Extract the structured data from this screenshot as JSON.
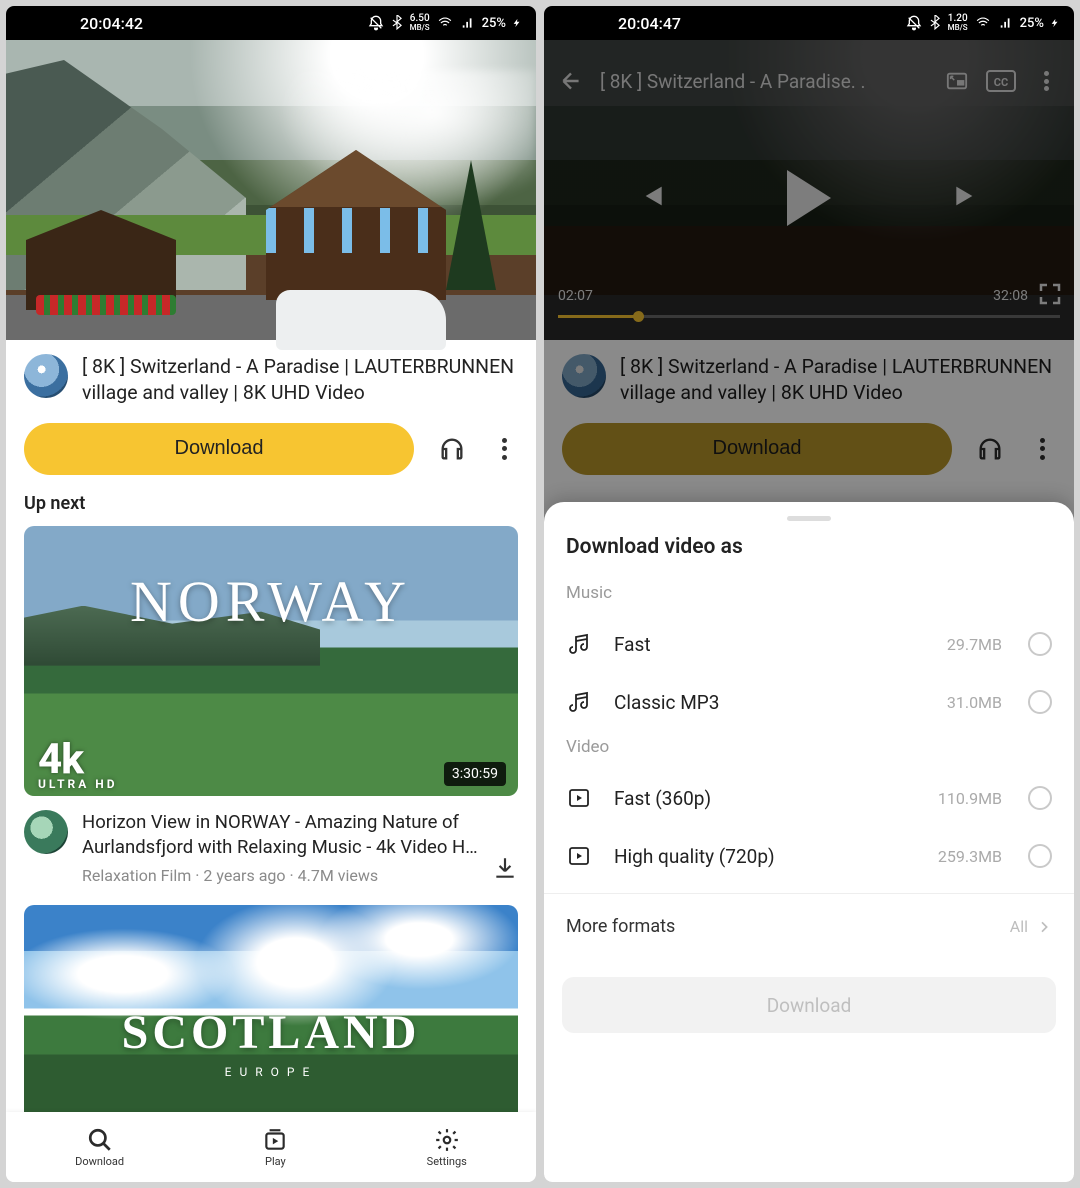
{
  "status_left": {
    "time": "20:04:42",
    "rate": "6.50",
    "rate_unit": "MB/S",
    "battery": "25%"
  },
  "status_right": {
    "time": "20:04:47",
    "rate": "1.20",
    "rate_unit": "MB/S",
    "battery": "25%"
  },
  "video": {
    "title": "[ 8K ] Switzerland - A Paradise | LAUTERBRUNNEN village and valley | 8K UHD Video",
    "download_label": "Download"
  },
  "player": {
    "title_short": "[ 8K ] Switzerland - A Paradise. .",
    "current": "02:07",
    "duration": "32:08"
  },
  "upnext": {
    "label": "Up next",
    "item": {
      "overlay_title": "NORWAY",
      "badge": "4k",
      "badge_sub": "ULTRA HD",
      "duration": "3:30:59",
      "title": "Horizon View in NORWAY - Amazing Nature of Aurlandsfjord with Relaxing Music - 4k Video HD Ul…",
      "channel": "Relaxation Film",
      "age": "2 years ago",
      "views": "4.7M views"
    },
    "item2": {
      "overlay_title": "SCOTLAND",
      "subtitle": "EUROPE"
    }
  },
  "nav": {
    "download": "Download",
    "play": "Play",
    "settings": "Settings"
  },
  "sheet": {
    "heading": "Download video as",
    "group_music": "Music",
    "group_video": "Video",
    "options_music": [
      {
        "label": "Fast",
        "size": "29.7MB"
      },
      {
        "label": "Classic MP3",
        "size": "31.0MB"
      }
    ],
    "options_video": [
      {
        "label": "Fast (360p)",
        "size": "110.9MB"
      },
      {
        "label": "High quality (720p)",
        "size": "259.3MB"
      }
    ],
    "more": "More formats",
    "more_value": "All",
    "confirm": "Download"
  }
}
